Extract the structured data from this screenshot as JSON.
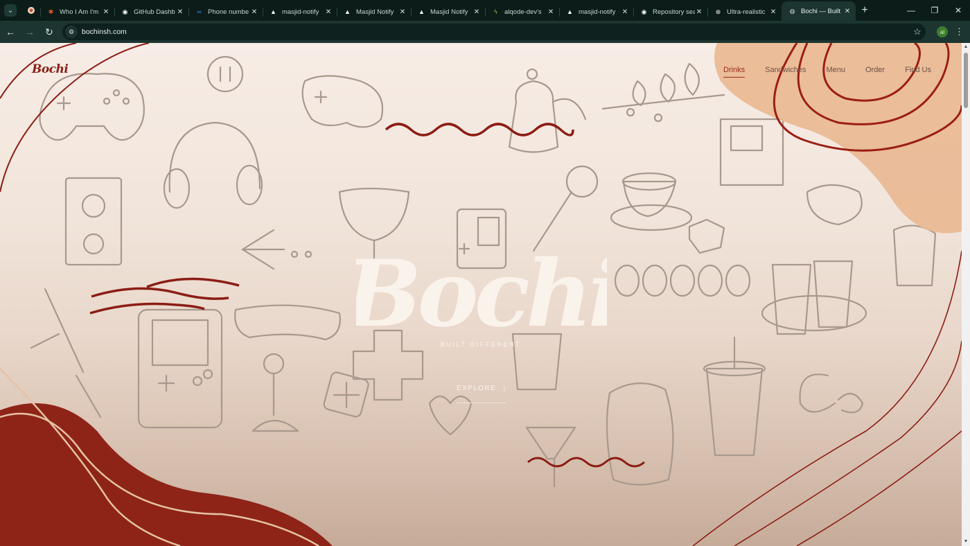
{
  "browser": {
    "tabs": [
      {
        "label": "Who I Am I'm",
        "icon": "asterisk-icon",
        "color": "#e4572e"
      },
      {
        "label": "GitHub Dashb",
        "icon": "github-icon",
        "color": "#ffffff"
      },
      {
        "label": "Phone numbe",
        "icon": "meta-icon",
        "color": "#3b82f6"
      },
      {
        "label": "masjid-notify",
        "icon": "vercel-icon",
        "color": "#ffffff"
      },
      {
        "label": "Masjid Notify",
        "icon": "vercel-icon",
        "color": "#ffffff"
      },
      {
        "label": "Masjid Notify",
        "icon": "vercel-icon",
        "color": "#ffffff"
      },
      {
        "label": "alqode-dev's",
        "icon": "bolt-icon",
        "color": "#8bc34a"
      },
      {
        "label": "masjid-notify",
        "icon": "vercel-icon",
        "color": "#ffffff"
      },
      {
        "label": "Repository sea",
        "icon": "github-icon",
        "color": "#ffffff"
      },
      {
        "label": "Ultra-realistic",
        "icon": "openai-icon",
        "color": "#ffffff"
      },
      {
        "label": "Bochi — Built",
        "icon": "globe-icon",
        "color": "#cfd8d6"
      }
    ],
    "active_tab_index": 10,
    "url": "bochinsh.com",
    "profile_initials": "al"
  },
  "site": {
    "logo": "Bochi",
    "nav": [
      {
        "label": "Drinks",
        "active": true
      },
      {
        "label": "Sandwiches",
        "active": false
      },
      {
        "label": "Menu",
        "active": false
      },
      {
        "label": "Order",
        "active": false
      },
      {
        "label": "Find Us",
        "active": false
      }
    ],
    "hero_title": "Bochi",
    "tagline": "BUILT DIFFERENT",
    "explore_label": "EXPLORE",
    "colors": {
      "brand_red": "#8b1f16",
      "peach": "#e9b892",
      "cream": "#fbf4ee"
    }
  }
}
